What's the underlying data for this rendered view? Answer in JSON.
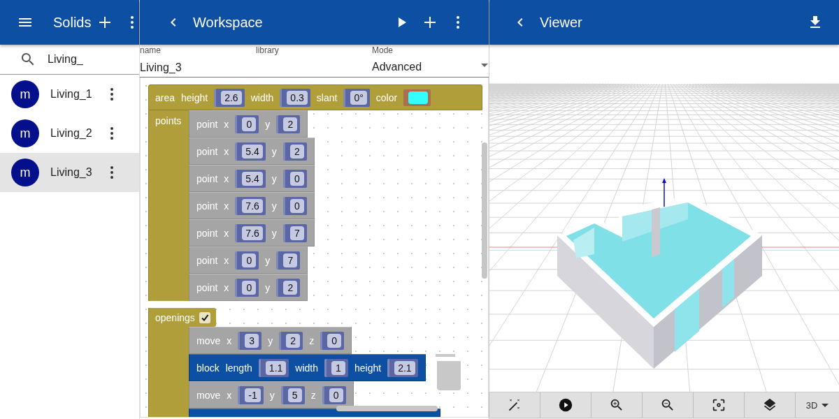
{
  "solids": {
    "title": "Solids",
    "search": {
      "value": "Living_"
    },
    "items": [
      {
        "avatar": "m",
        "name": "Living_1",
        "selected": false
      },
      {
        "avatar": "m",
        "name": "Living_2",
        "selected": false
      },
      {
        "avatar": "m",
        "name": "Living_3",
        "selected": true
      }
    ]
  },
  "workspace": {
    "title": "Workspace",
    "fields": [
      {
        "label": "name",
        "value": "Living_3",
        "kind": "text"
      },
      {
        "label": "library",
        "kind": "text"
      },
      {
        "label": "Mode",
        "value": "Advanced",
        "kind": "select"
      }
    ],
    "area": {
      "label": "area",
      "params": [
        {
          "name": "height",
          "value": "2.6",
          "kind": "number"
        },
        {
          "name": "width",
          "value": "0.3",
          "kind": "number"
        },
        {
          "name": "slant",
          "value": "0°",
          "kind": "number"
        },
        {
          "name": "color",
          "kind": "color",
          "color": "#33ffff"
        }
      ],
      "points_label": "points",
      "points": [
        {
          "label": "point",
          "params": [
            {
              "name": "x",
              "value": "0"
            },
            {
              "name": "y",
              "value": "2"
            }
          ]
        },
        {
          "label": "point",
          "params": [
            {
              "name": "x",
              "value": "5.4"
            },
            {
              "name": "y",
              "value": "2"
            }
          ]
        },
        {
          "label": "point",
          "params": [
            {
              "name": "x",
              "value": "5.4"
            },
            {
              "name": "y",
              "value": "0"
            }
          ]
        },
        {
          "label": "point",
          "params": [
            {
              "name": "x",
              "value": "7.6"
            },
            {
              "name": "y",
              "value": "0"
            }
          ]
        },
        {
          "label": "point",
          "params": [
            {
              "name": "x",
              "value": "7.6"
            },
            {
              "name": "y",
              "value": "7"
            }
          ]
        },
        {
          "label": "point",
          "params": [
            {
              "name": "x",
              "value": "0"
            },
            {
              "name": "y",
              "value": "7"
            }
          ]
        },
        {
          "label": "point",
          "params": [
            {
              "name": "x",
              "value": "0"
            },
            {
              "name": "y",
              "value": "2"
            }
          ]
        }
      ],
      "openings_label": "openings",
      "openings_checked": true,
      "openings": [
        {
          "kind": "move",
          "label": "move",
          "params": [
            {
              "name": "x",
              "value": "3"
            },
            {
              "name": "y",
              "value": "2"
            },
            {
              "name": "z",
              "value": "0"
            }
          ]
        },
        {
          "kind": "block",
          "label": "block",
          "params": [
            {
              "name": "length",
              "value": "1.1"
            },
            {
              "name": "width",
              "value": "1"
            },
            {
              "name": "height",
              "value": "2.1"
            }
          ]
        },
        {
          "kind": "move",
          "label": "move",
          "params": [
            {
              "name": "x",
              "value": "-1"
            },
            {
              "name": "y",
              "value": "5"
            },
            {
              "name": "z",
              "value": "0"
            }
          ]
        },
        {
          "kind": "block"
        }
      ]
    }
  },
  "viewer": {
    "title": "Viewer",
    "view_mode": "3D"
  }
}
